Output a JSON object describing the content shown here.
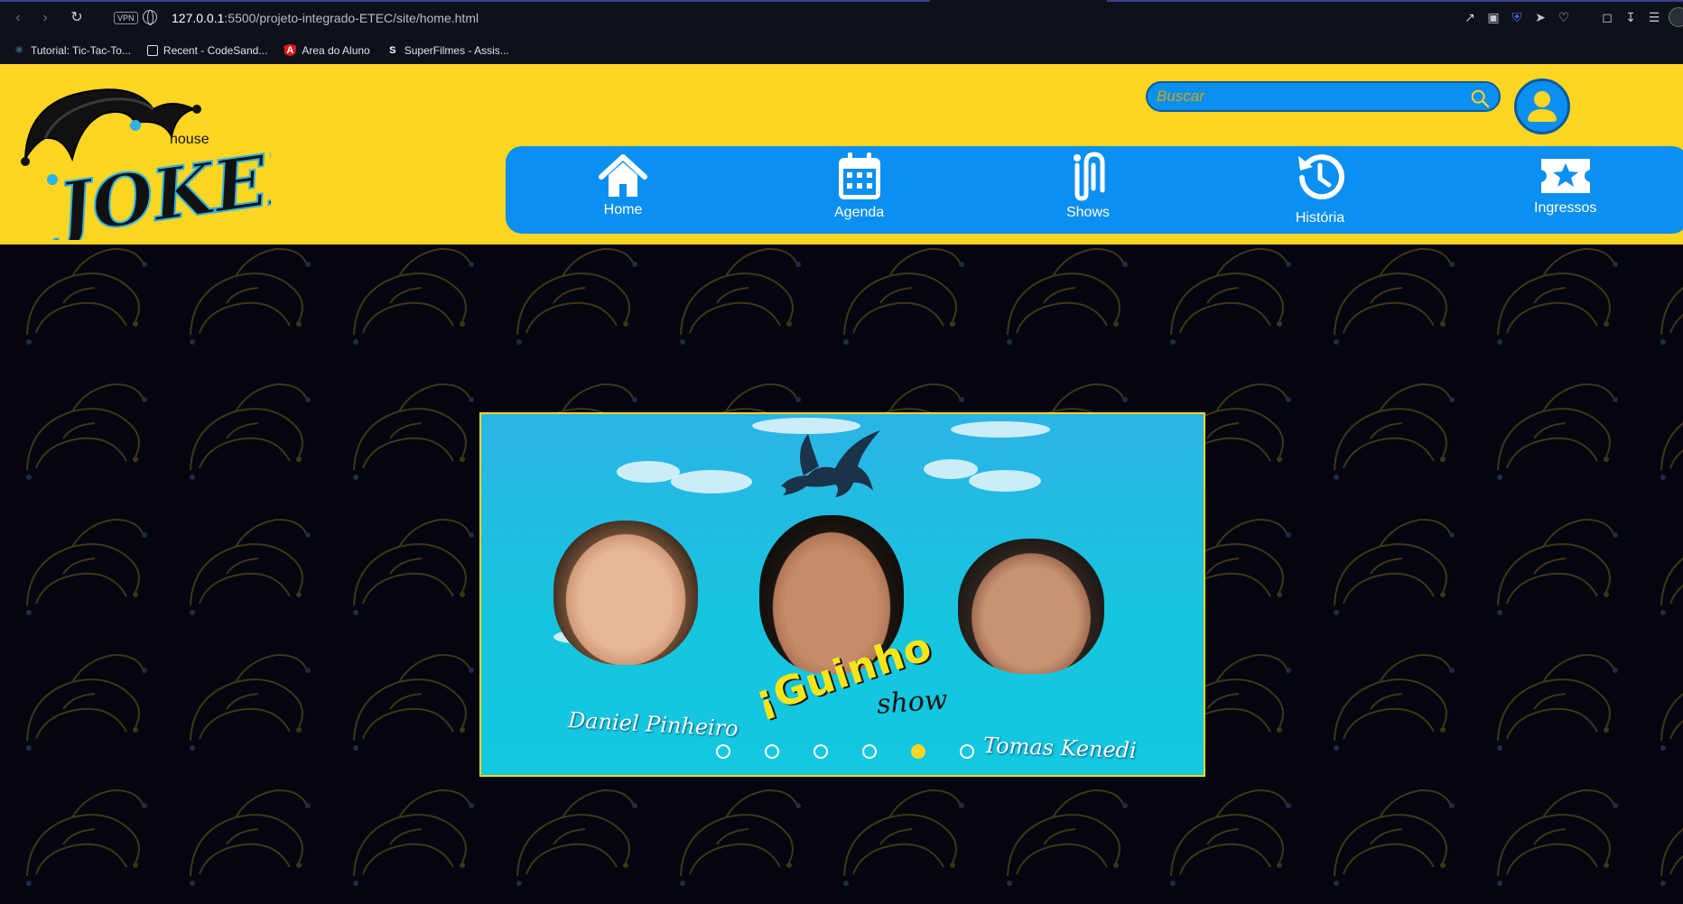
{
  "browser": {
    "url_host": "127.0.0.1",
    "url_path": ":5500/projeto-integrado-ETEC/site/home.html",
    "vpn_label": "VPN",
    "bookmarks": [
      {
        "label": "Tutorial: Tic-Tac-To...",
        "icon": "react-icon"
      },
      {
        "label": "Recent - CodeSand...",
        "icon": "codesandbox-icon"
      },
      {
        "label": "Area do Aluno",
        "icon": "angular-icon"
      },
      {
        "label": "SuperFilmes - Assis...",
        "icon": "s-icon"
      }
    ]
  },
  "header": {
    "logo_text_small": "house",
    "logo_text_big": "JOKER",
    "search_placeholder": "Buscar",
    "colors": {
      "header_bg": "#fdd523",
      "nav_bg": "#0b8ff0",
      "page_bg": "#05050f"
    }
  },
  "nav": [
    {
      "label": "Home",
      "icon": "home-icon"
    },
    {
      "label": "Agenda",
      "icon": "calendar-icon"
    },
    {
      "label": "Shows",
      "icon": "paperclip-icon"
    },
    {
      "label": "História",
      "icon": "history-icon"
    },
    {
      "label": "Ingressos",
      "icon": "ticket-icon"
    }
  ],
  "carousel": {
    "caption_left": "Daniel Pinheiro",
    "caption_right": "Tomas Kenedi",
    "title": "¡Guinho",
    "subtitle": "show",
    "slide_count": 6,
    "active_index": 4
  }
}
